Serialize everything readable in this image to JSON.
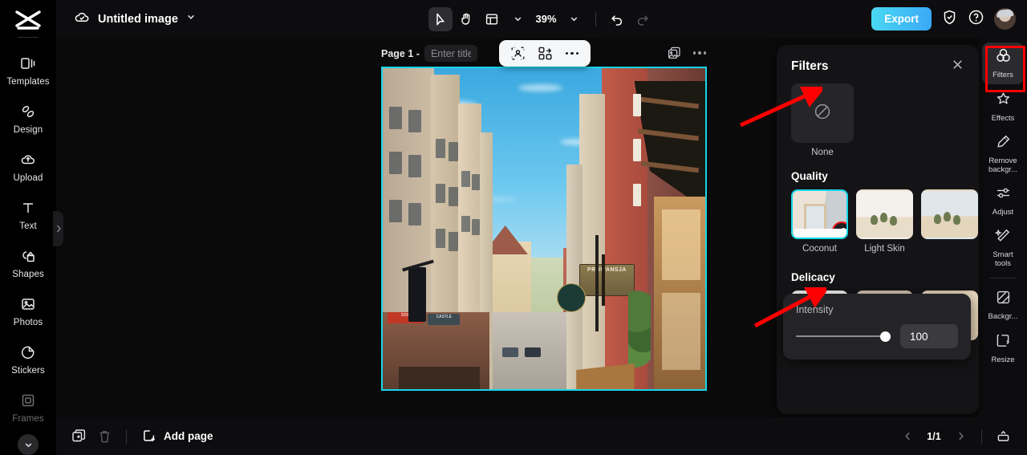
{
  "app": {
    "brand_icon": "capcut-logo-icon",
    "accent_color": "#15d6e8",
    "annotation_color": "#ff0000"
  },
  "left_sidebar": {
    "items": [
      {
        "label": "Templates",
        "icon": "templates-icon"
      },
      {
        "label": "Design",
        "icon": "design-icon"
      },
      {
        "label": "Upload",
        "icon": "upload-cloud-icon"
      },
      {
        "label": "Text",
        "icon": "text-icon"
      },
      {
        "label": "Shapes",
        "icon": "shapes-icon"
      },
      {
        "label": "Photos",
        "icon": "photos-icon"
      },
      {
        "label": "Stickers",
        "icon": "stickers-icon"
      },
      {
        "label": "Frames",
        "icon": "frames-icon"
      }
    ],
    "expand_icon": "chevron-down-icon",
    "panel_handle_icon": "chevron-right-icon"
  },
  "topbar": {
    "cloud_icon": "cloud-saved-icon",
    "doc_title": "Untitled image",
    "title_chevron": "chevron-down-icon",
    "tools": [
      {
        "name": "select-tool",
        "icon": "cursor-icon",
        "active": true
      },
      {
        "name": "hand-tool",
        "icon": "hand-icon",
        "active": false
      },
      {
        "name": "layout-tool",
        "icon": "layout-icon",
        "active": false
      }
    ],
    "zoom_level": "39%",
    "zoom_chevron": "chevron-down-icon",
    "undo_icon": "undo-icon",
    "redo_icon": "redo-icon",
    "export_label": "Export",
    "shield_icon": "shield-check-icon",
    "help_icon": "help-circle-icon",
    "avatar": "user-avatar"
  },
  "canvas": {
    "page_label": "Page 1 -",
    "title_placeholder": "Enter title",
    "title_value": "",
    "duplicate_icon": "duplicate-image-icon",
    "more_icon": "more-options-icon",
    "float_toolbar": [
      {
        "name": "cutout-button",
        "icon": "cutout-icon"
      },
      {
        "name": "replace-button",
        "icon": "replace-swap-icon"
      },
      {
        "name": "more-button",
        "icon": "more-options-icon"
      }
    ],
    "image_signs": [
      "PROWANSJA",
      "DISCO",
      "CASTLE",
      "2000"
    ]
  },
  "filters_panel": {
    "title": "Filters",
    "close_icon": "close-icon",
    "none": {
      "label": "None",
      "icon": "no-filter-icon"
    },
    "sections": [
      {
        "title": "Quality",
        "items": [
          {
            "label": "Coconut",
            "selected": true,
            "badge_icon": "adjust-sliders-icon",
            "art": "t-room"
          },
          {
            "label": "Light Skin",
            "selected": false,
            "art": "t-desert"
          },
          {
            "label": "",
            "selected": false,
            "art": "t-desert2"
          }
        ]
      },
      {
        "title": "Delicacy",
        "items": [
          {
            "label": "",
            "selected": false,
            "art": "t-white"
          },
          {
            "label": "",
            "selected": false,
            "art": "t-tan"
          },
          {
            "label": "",
            "selected": false,
            "art": "t-tan2"
          }
        ]
      }
    ],
    "intensity": {
      "label": "Intensity",
      "value": "100",
      "percent": 100
    }
  },
  "right_rail": {
    "items": [
      {
        "label": "Filters",
        "icon": "filters-circles-icon",
        "active": true
      },
      {
        "label": "Effects",
        "icon": "effects-star-icon",
        "active": false
      },
      {
        "label": "Remove backgr...",
        "icon": "remove-background-icon",
        "active": false
      },
      {
        "label": "Adjust",
        "icon": "adjust-sliders-icon",
        "active": false
      },
      {
        "label": "Smart tools",
        "icon": "smart-tools-wand-icon",
        "active": false
      },
      {
        "label": "Backgr...",
        "icon": "background-icon",
        "active": false
      },
      {
        "label": "Resize",
        "icon": "resize-icon",
        "active": false
      }
    ]
  },
  "bottombar": {
    "duplicate_icon": "duplicate-page-icon",
    "delete_icon": "trash-icon",
    "add_page_label": "Add page",
    "add_page_icon": "add-page-icon",
    "prev_icon": "chevron-left-icon",
    "page_indicator": "1/1",
    "next_icon": "chevron-right-icon",
    "present_icon": "present-icon"
  }
}
